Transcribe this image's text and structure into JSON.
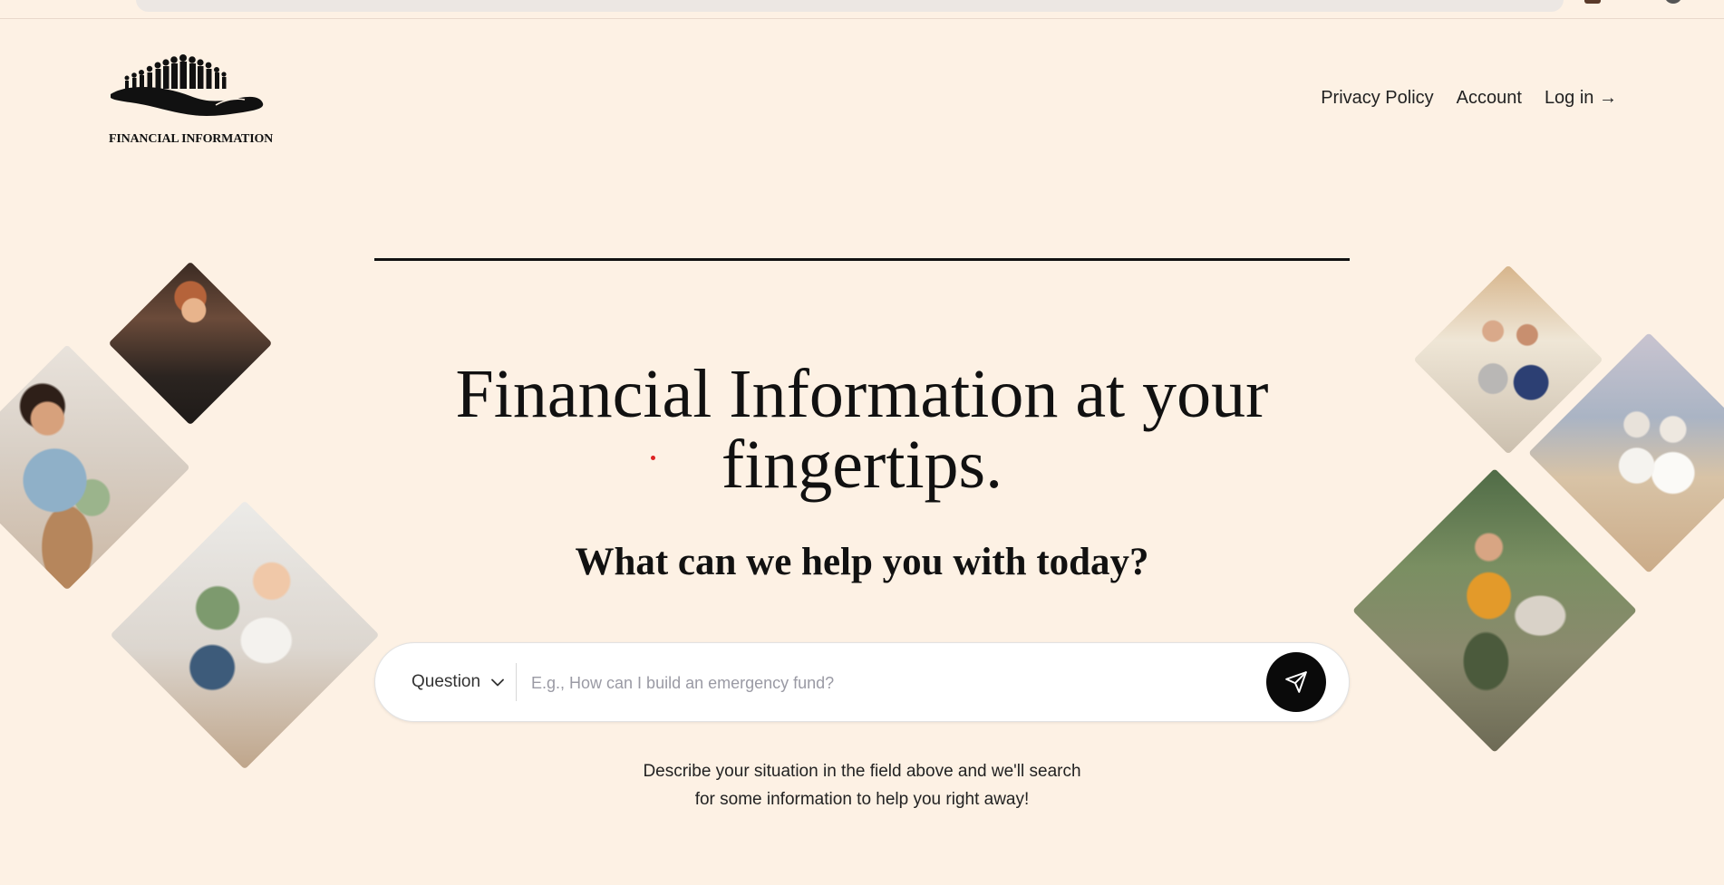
{
  "logo": {
    "text": "FINANCIAL INFORMATION"
  },
  "nav": {
    "privacy": "Privacy Policy",
    "account": "Account",
    "login": "Log in →"
  },
  "hero": {
    "title_line1": "Financial Information at your",
    "title_line2": "fingertips.",
    "subtitle": "What can we help you with today?"
  },
  "search": {
    "type_label": "Question",
    "placeholder": "E.g., How can I build an emergency fund?",
    "value": ""
  },
  "helper": {
    "line1": "Describe your situation in the field above and we'll search",
    "line2": "for some information to help you right away!"
  },
  "colors": {
    "background": "#fdf1e4",
    "button": "#0a0a0a",
    "text": "#111111"
  },
  "images": [
    "barista-pouring-coffee-photo",
    "woman-repotting-plant-photo",
    "baby-walking-photo",
    "couple-on-porch-photo",
    "senior-couple-beach-photo",
    "family-hiking-photo"
  ]
}
